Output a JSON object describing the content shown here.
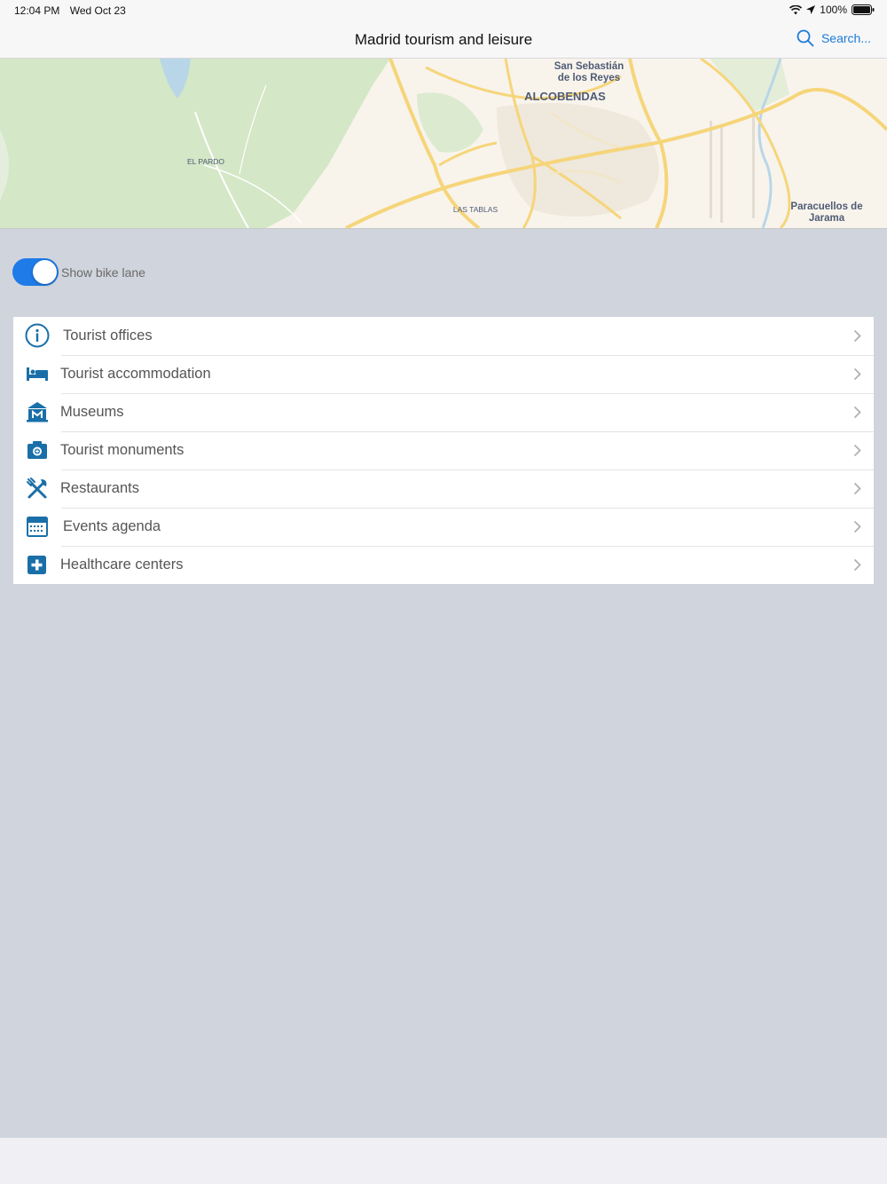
{
  "status_bar": {
    "time": "12:04 PM",
    "date": "Wed Oct 23",
    "battery": "100%"
  },
  "nav": {
    "title": "Madrid tourism and leisure",
    "search_label": "Search..."
  },
  "map": {
    "labels": {
      "san_sebastian": "San Sebastián\nde los Reyes",
      "alcobendas": "ALCOBENDAS",
      "el_pardo": "EL PARDO",
      "las_tablas": "LAS TABLAS",
      "paracuellos": "Paracuellos de\nJarama"
    },
    "colors": {
      "land": "#f8f4ec",
      "park": "#d6e8c8",
      "road": "#f7d97a",
      "water": "#b9d6e8"
    }
  },
  "bike_lane": {
    "label": "Show bike lane",
    "enabled": true
  },
  "categories": [
    {
      "label": "Tourist offices",
      "icon": "info-icon"
    },
    {
      "label": "Tourist accommodation",
      "icon": "bed-icon"
    },
    {
      "label": "Museums",
      "icon": "museum-icon"
    },
    {
      "label": "Tourist monuments",
      "icon": "camera-icon"
    },
    {
      "label": "Restaurants",
      "icon": "cutlery-icon"
    },
    {
      "label": "Events agenda",
      "icon": "calendar-icon"
    },
    {
      "label": "Healthcare centers",
      "icon": "medical-cross-icon"
    }
  ],
  "colors": {
    "accent": "#1a7ad9",
    "icon": "#1a6fa8",
    "toggle_on": "#1e7be8",
    "background": "#d0d4dc"
  }
}
